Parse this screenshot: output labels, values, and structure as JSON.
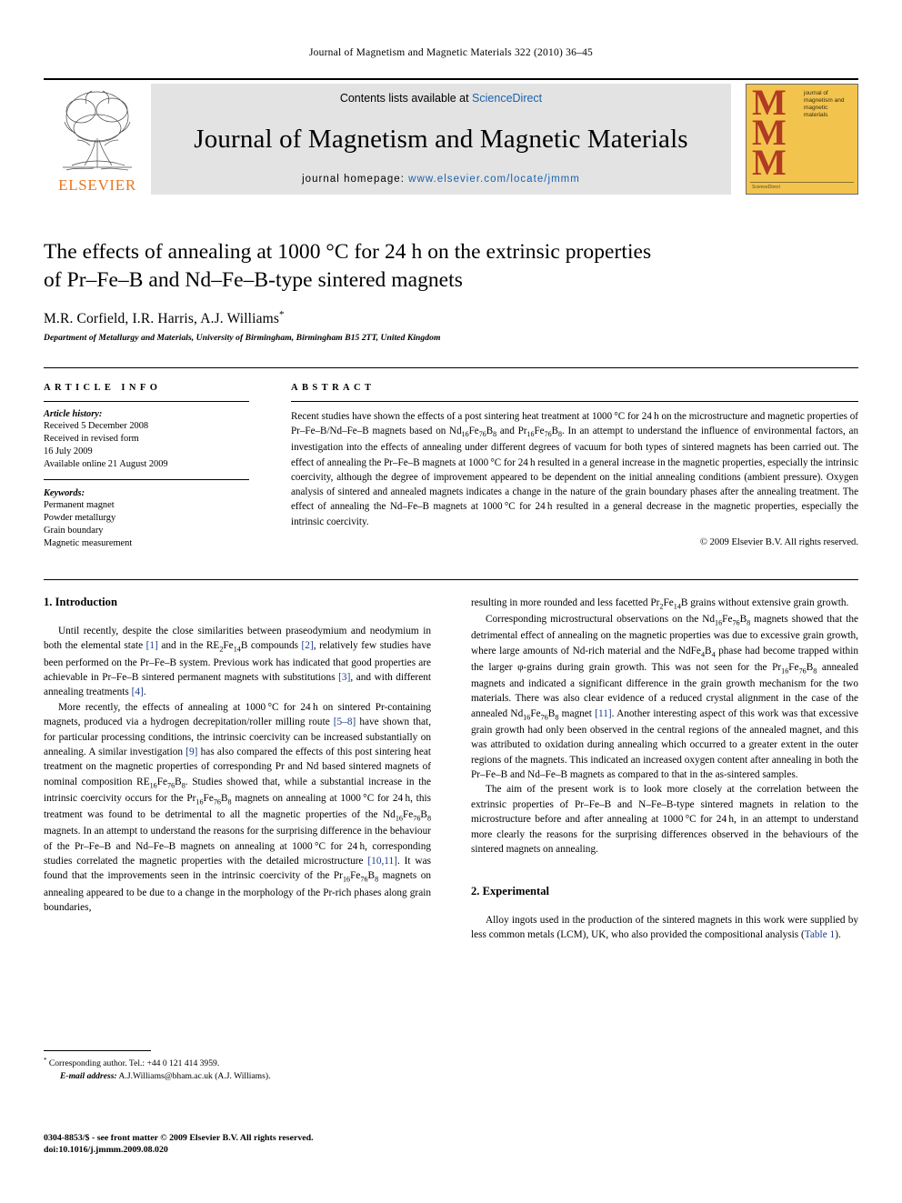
{
  "running_head": "Journal of Magnetism and Magnetic Materials 322 (2010) 36–45",
  "masthead": {
    "contents_prefix": "Contents lists available at ",
    "sciencedirect": "ScienceDirect",
    "journal_title": "Journal of Magnetism and Magnetic Materials",
    "homepage_prefix": "journal homepage: ",
    "homepage_url": "www.elsevier.com/locate/jmmm",
    "publisher": "ELSEVIER",
    "cover_initials": "MMM",
    "cover_words": "journal of magnetism and magnetic materials",
    "cover_footer": "ScienceDirect",
    "colors": {
      "link": "#1a62ad",
      "elsevier_orange": "#E87722",
      "cover_background": "#f2c44d",
      "cover_letter": "#b03a24",
      "masthead_panel": "#e3e3e3"
    }
  },
  "article": {
    "title_line1": "The effects of annealing at 1000 °C for 24 h on the extrinsic properties",
    "title_line2": "of Pr–Fe–B and Nd–Fe–B-type sintered magnets",
    "authors": "M.R. Corfield, I.R. Harris, A.J. Williams",
    "corresponding_marker": "*",
    "affiliation": "Department of Metallurgy and Materials, University of Birmingham, Birmingham B15 2TT, United Kingdom"
  },
  "article_info": {
    "heading": "ARTICLE INFO",
    "history_label": "Article history:",
    "history": [
      "Received 5 December 2008",
      "Received in revised form",
      "16 July 2009",
      "Available online 21 August 2009"
    ],
    "keywords_label": "Keywords:",
    "keywords": [
      "Permanent magnet",
      "Powder metallurgy",
      "Grain boundary",
      "Magnetic measurement"
    ]
  },
  "abstract": {
    "heading": "ABSTRACT",
    "copyright": "© 2009 Elsevier B.V. All rights reserved."
  },
  "sections": {
    "introduction_heading": "1. Introduction",
    "experimental_heading": "2. Experimental"
  },
  "footnote": {
    "corresponding": "Corresponding author. Tel.: +44 0 121 414 3959.",
    "email_label": "E-mail address:",
    "email": "A.J.Williams@bham.ac.uk (A.J. Williams)."
  },
  "imprint": {
    "line1": "0304-8853/$ - see front matter © 2009 Elsevier B.V. All rights reserved.",
    "line2": "doi:10.1016/j.jmmm.2009.08.020"
  }
}
